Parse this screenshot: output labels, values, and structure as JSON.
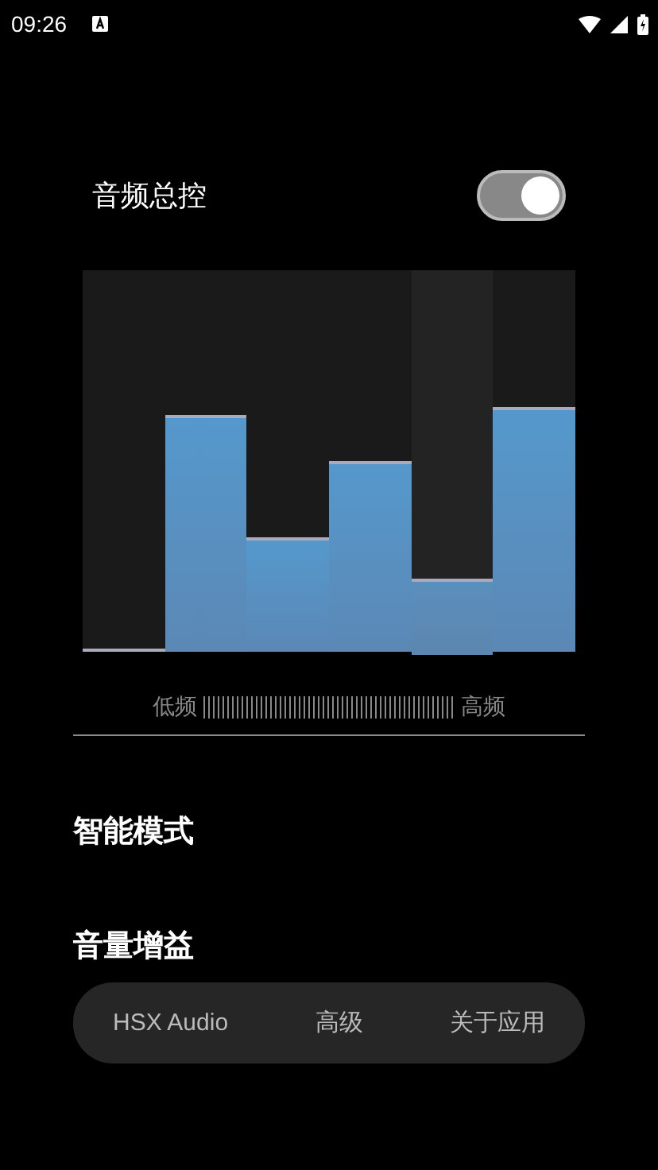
{
  "status_bar": {
    "time": "09:26"
  },
  "master": {
    "label": "音频总控",
    "on": true
  },
  "equalizer": {
    "bands": [
      {
        "level": 0,
        "selected": false
      },
      {
        "level": 0.62,
        "selected": false
      },
      {
        "level": 0.3,
        "selected": false
      },
      {
        "level": 0.5,
        "selected": false
      },
      {
        "level": 0.2,
        "selected": true
      },
      {
        "level": 0.64,
        "selected": false
      }
    ],
    "low_label": "低频",
    "high_label": "高频"
  },
  "sections": [
    "智能模式",
    "音量增益"
  ],
  "nav": [
    {
      "label": "HSX Audio",
      "selected": false
    },
    {
      "label": "高级",
      "selected": false
    },
    {
      "label": "关于应用",
      "selected": false
    }
  ]
}
